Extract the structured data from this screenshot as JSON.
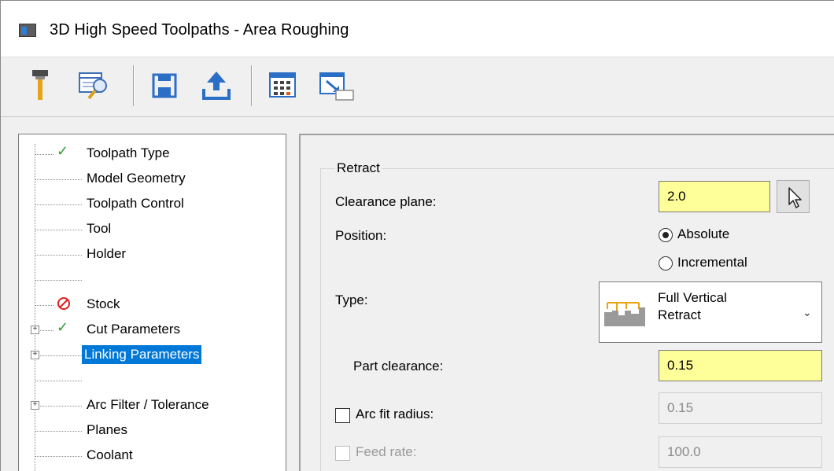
{
  "window": {
    "title": "3D High Speed Toolpaths - Area Roughing"
  },
  "toolbar": {
    "icons": [
      "tool-icon",
      "preview-icon",
      "save-icon",
      "export-icon",
      "calculator-icon",
      "minimize-icon"
    ]
  },
  "tree": {
    "items": [
      {
        "label": "Toolpath Type",
        "status": "check"
      },
      {
        "label": "Model Geometry",
        "status": ""
      },
      {
        "label": "Toolpath Control",
        "status": ""
      },
      {
        "label": "Tool",
        "status": ""
      },
      {
        "label": "Holder",
        "status": ""
      },
      {
        "label": "Stock",
        "status": "error"
      },
      {
        "label": "Cut Parameters",
        "status": "check"
      },
      {
        "label": "Linking Parameters",
        "status": "selected"
      },
      {
        "label": "Arc Filter / Tolerance",
        "status": ""
      },
      {
        "label": "Planes",
        "status": ""
      },
      {
        "label": "Coolant",
        "status": ""
      }
    ]
  },
  "retract": {
    "group_label": "Retract",
    "clearance_label": "Clearance plane:",
    "clearance_value": "2.0",
    "position_label": "Position:",
    "position_options": [
      "Absolute",
      "Incremental"
    ],
    "position_selected": "Absolute",
    "type_label": "Type:",
    "type_value_line1": "Full Vertical",
    "type_value_line2": "Retract",
    "part_clearance_label": "Part clearance:",
    "part_clearance_value": "0.15",
    "arc_fit_label": "Arc fit radius:",
    "arc_fit_value": "0.15",
    "arc_fit_checked": false,
    "feed_rate_label": "Feed rate:",
    "feed_rate_value": "100.0",
    "feed_rate_checked": false
  },
  "colors": {
    "accent": "#0078d7",
    "highlight_field": "#ffff99",
    "check_green": "#2e9c2e",
    "error_red": "#e02020"
  }
}
